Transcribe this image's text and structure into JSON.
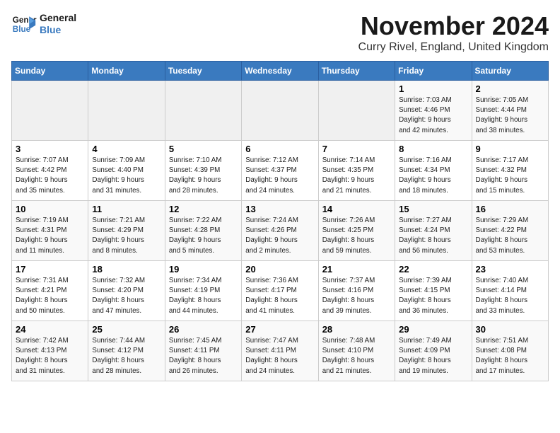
{
  "header": {
    "logo_line1": "General",
    "logo_line2": "Blue",
    "month": "November 2024",
    "location": "Curry Rivel, England, United Kingdom"
  },
  "weekdays": [
    "Sunday",
    "Monday",
    "Tuesday",
    "Wednesday",
    "Thursday",
    "Friday",
    "Saturday"
  ],
  "weeks": [
    [
      {
        "day": "",
        "info": ""
      },
      {
        "day": "",
        "info": ""
      },
      {
        "day": "",
        "info": ""
      },
      {
        "day": "",
        "info": ""
      },
      {
        "day": "",
        "info": ""
      },
      {
        "day": "1",
        "info": "Sunrise: 7:03 AM\nSunset: 4:46 PM\nDaylight: 9 hours\nand 42 minutes."
      },
      {
        "day": "2",
        "info": "Sunrise: 7:05 AM\nSunset: 4:44 PM\nDaylight: 9 hours\nand 38 minutes."
      }
    ],
    [
      {
        "day": "3",
        "info": "Sunrise: 7:07 AM\nSunset: 4:42 PM\nDaylight: 9 hours\nand 35 minutes."
      },
      {
        "day": "4",
        "info": "Sunrise: 7:09 AM\nSunset: 4:40 PM\nDaylight: 9 hours\nand 31 minutes."
      },
      {
        "day": "5",
        "info": "Sunrise: 7:10 AM\nSunset: 4:39 PM\nDaylight: 9 hours\nand 28 minutes."
      },
      {
        "day": "6",
        "info": "Sunrise: 7:12 AM\nSunset: 4:37 PM\nDaylight: 9 hours\nand 24 minutes."
      },
      {
        "day": "7",
        "info": "Sunrise: 7:14 AM\nSunset: 4:35 PM\nDaylight: 9 hours\nand 21 minutes."
      },
      {
        "day": "8",
        "info": "Sunrise: 7:16 AM\nSunset: 4:34 PM\nDaylight: 9 hours\nand 18 minutes."
      },
      {
        "day": "9",
        "info": "Sunrise: 7:17 AM\nSunset: 4:32 PM\nDaylight: 9 hours\nand 15 minutes."
      }
    ],
    [
      {
        "day": "10",
        "info": "Sunrise: 7:19 AM\nSunset: 4:31 PM\nDaylight: 9 hours\nand 11 minutes."
      },
      {
        "day": "11",
        "info": "Sunrise: 7:21 AM\nSunset: 4:29 PM\nDaylight: 9 hours\nand 8 minutes."
      },
      {
        "day": "12",
        "info": "Sunrise: 7:22 AM\nSunset: 4:28 PM\nDaylight: 9 hours\nand 5 minutes."
      },
      {
        "day": "13",
        "info": "Sunrise: 7:24 AM\nSunset: 4:26 PM\nDaylight: 9 hours\nand 2 minutes."
      },
      {
        "day": "14",
        "info": "Sunrise: 7:26 AM\nSunset: 4:25 PM\nDaylight: 8 hours\nand 59 minutes."
      },
      {
        "day": "15",
        "info": "Sunrise: 7:27 AM\nSunset: 4:24 PM\nDaylight: 8 hours\nand 56 minutes."
      },
      {
        "day": "16",
        "info": "Sunrise: 7:29 AM\nSunset: 4:22 PM\nDaylight: 8 hours\nand 53 minutes."
      }
    ],
    [
      {
        "day": "17",
        "info": "Sunrise: 7:31 AM\nSunset: 4:21 PM\nDaylight: 8 hours\nand 50 minutes."
      },
      {
        "day": "18",
        "info": "Sunrise: 7:32 AM\nSunset: 4:20 PM\nDaylight: 8 hours\nand 47 minutes."
      },
      {
        "day": "19",
        "info": "Sunrise: 7:34 AM\nSunset: 4:19 PM\nDaylight: 8 hours\nand 44 minutes."
      },
      {
        "day": "20",
        "info": "Sunrise: 7:36 AM\nSunset: 4:17 PM\nDaylight: 8 hours\nand 41 minutes."
      },
      {
        "day": "21",
        "info": "Sunrise: 7:37 AM\nSunset: 4:16 PM\nDaylight: 8 hours\nand 39 minutes."
      },
      {
        "day": "22",
        "info": "Sunrise: 7:39 AM\nSunset: 4:15 PM\nDaylight: 8 hours\nand 36 minutes."
      },
      {
        "day": "23",
        "info": "Sunrise: 7:40 AM\nSunset: 4:14 PM\nDaylight: 8 hours\nand 33 minutes."
      }
    ],
    [
      {
        "day": "24",
        "info": "Sunrise: 7:42 AM\nSunset: 4:13 PM\nDaylight: 8 hours\nand 31 minutes."
      },
      {
        "day": "25",
        "info": "Sunrise: 7:44 AM\nSunset: 4:12 PM\nDaylight: 8 hours\nand 28 minutes."
      },
      {
        "day": "26",
        "info": "Sunrise: 7:45 AM\nSunset: 4:11 PM\nDaylight: 8 hours\nand 26 minutes."
      },
      {
        "day": "27",
        "info": "Sunrise: 7:47 AM\nSunset: 4:11 PM\nDaylight: 8 hours\nand 24 minutes."
      },
      {
        "day": "28",
        "info": "Sunrise: 7:48 AM\nSunset: 4:10 PM\nDaylight: 8 hours\nand 21 minutes."
      },
      {
        "day": "29",
        "info": "Sunrise: 7:49 AM\nSunset: 4:09 PM\nDaylight: 8 hours\nand 19 minutes."
      },
      {
        "day": "30",
        "info": "Sunrise: 7:51 AM\nSunset: 4:08 PM\nDaylight: 8 hours\nand 17 minutes."
      }
    ]
  ]
}
